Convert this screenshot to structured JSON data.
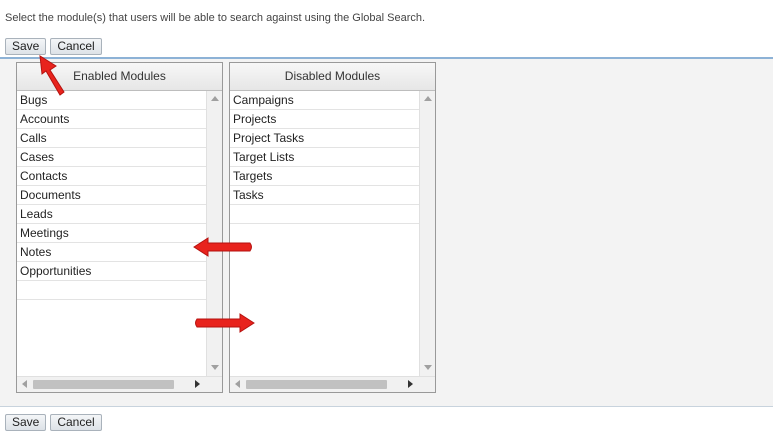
{
  "instructions": "Select the module(s) that users will be able to search against using the Global Search.",
  "buttons": {
    "save": "Save",
    "cancel": "Cancel"
  },
  "enabled_modules": {
    "header": "Enabled Modules",
    "items": [
      "Bugs",
      "Accounts",
      "Calls",
      "Cases",
      "Contacts",
      "Documents",
      "Leads",
      "Meetings",
      "Notes",
      "Opportunities"
    ]
  },
  "disabled_modules": {
    "header": "Disabled Modules",
    "items": [
      "Campaigns",
      "Projects",
      "Project Tasks",
      "Target Lists",
      "Targets",
      "Tasks"
    ]
  },
  "colors": {
    "accent_border": "#8db2d6",
    "annotation_arrow": "#e8231d"
  },
  "icons": [
    "scroll-up-icon",
    "scroll-down-icon",
    "scroll-left-icon",
    "scroll-right-icon",
    "red-arrow-annotation"
  ]
}
